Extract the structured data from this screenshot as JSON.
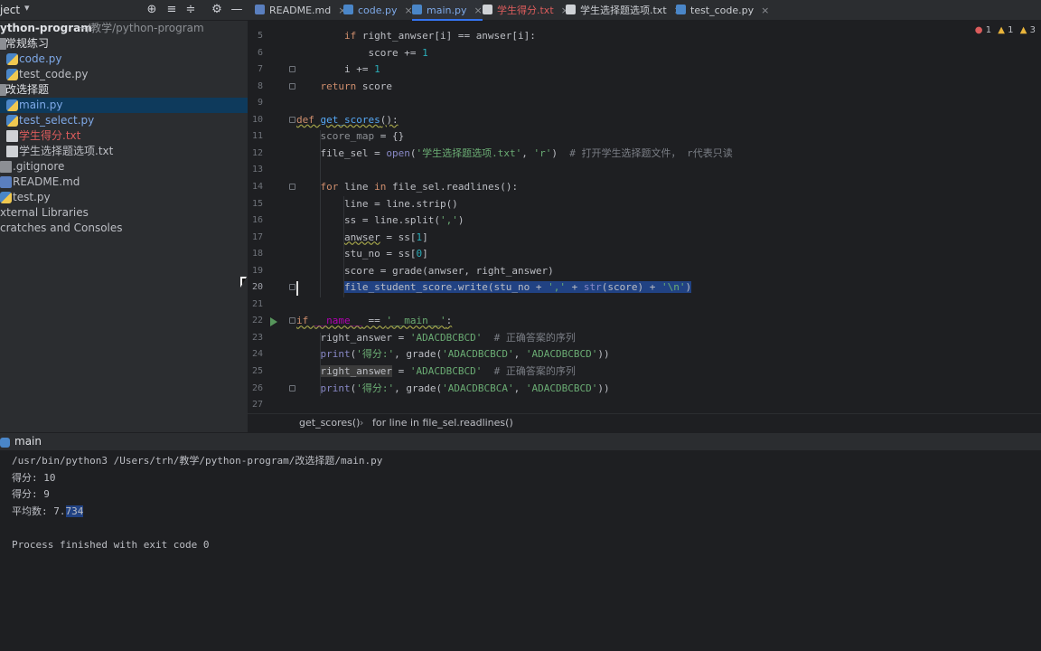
{
  "project": {
    "title": "ject",
    "root_name": "ython-program",
    "root_path": "~/教学/python-program",
    "items": [
      {
        "label": "常规练习",
        "kind": "folder",
        "indent": 0
      },
      {
        "label": "code.py",
        "kind": "py",
        "indent": 1,
        "color": "#7ea9e8"
      },
      {
        "label": "test_code.py",
        "kind": "py",
        "indent": 1,
        "color": "#bcbec4"
      },
      {
        "label": "改选择题",
        "kind": "folder",
        "indent": 0
      },
      {
        "label": "main.py",
        "kind": "py",
        "indent": 1,
        "color": "#7ea9e8",
        "selected": true
      },
      {
        "label": "test_select.py",
        "kind": "py",
        "indent": 1,
        "color": "#7ea9e8"
      },
      {
        "label": "学生得分.txt",
        "kind": "txt",
        "indent": 1,
        "color": "#db5c5c"
      },
      {
        "label": "学生选择题选项.txt",
        "kind": "txt",
        "indent": 1,
        "color": "#bcbec4"
      },
      {
        "label": ".gitignore",
        "kind": "file",
        "indent": 0,
        "color": "#bcbec4"
      },
      {
        "label": "README.md",
        "kind": "md",
        "indent": 0,
        "color": "#bcbec4"
      },
      {
        "label": "test.py",
        "kind": "py",
        "indent": 0,
        "color": "#bcbec4"
      },
      {
        "label": "xternal Libraries",
        "kind": "lib",
        "indent": -1,
        "color": "#bcbec4"
      },
      {
        "label": "cratches and Consoles",
        "kind": "lib",
        "indent": -1,
        "color": "#bcbec4"
      }
    ]
  },
  "tabs": [
    {
      "label": "README.md",
      "icon_color": "#5a7fbf",
      "color": "#c9ccd1"
    },
    {
      "label": "code.py",
      "icon_color": "#4a86c8",
      "color": "#7ea9e8"
    },
    {
      "label": "main.py",
      "icon_color": "#4a86c8",
      "color": "#7ea9e8",
      "active": true
    },
    {
      "label": "学生得分.txt",
      "icon_color": "#cfd2d6",
      "color": "#db5c5c"
    },
    {
      "label": "学生选择题选项.txt",
      "icon_color": "#cfd2d6",
      "color": "#c9ccd1"
    },
    {
      "label": "test_code.py",
      "icon_color": "#4a86c8",
      "color": "#c9ccd1"
    }
  ],
  "inspection": {
    "errors": "1",
    "warnings": "1",
    "weak": "3"
  },
  "editor": {
    "line_numbers": [
      "5",
      "6",
      "7",
      "8",
      "9",
      "10",
      "11",
      "12",
      "13",
      "14",
      "15",
      "16",
      "17",
      "18",
      "19",
      "20",
      "21",
      "22",
      "23",
      "24",
      "25",
      "26",
      "27"
    ],
    "current_line": "20",
    "lines": [
      [
        {
          "t": "        "
        },
        {
          "t": "if ",
          "c": "kw"
        },
        {
          "t": "right_anwser[i] == anwser[i]:"
        }
      ],
      [
        {
          "t": "            score += "
        },
        {
          "t": "1",
          "c": "num"
        }
      ],
      [
        {
          "t": "        i += "
        },
        {
          "t": "1",
          "c": "num"
        }
      ],
      [
        {
          "t": "    "
        },
        {
          "t": "return ",
          "c": "kw"
        },
        {
          "t": "score"
        }
      ],
      [
        {
          "t": ""
        }
      ],
      [
        {
          "t": "def ",
          "c": "kw ul"
        },
        {
          "t": "get_scores",
          "c": "fn ul"
        },
        {
          "t": "():",
          "c": "ul"
        }
      ],
      [
        {
          "t": "    "
        },
        {
          "t": "score_map",
          "c": "dim"
        },
        {
          "t": " = {}"
        }
      ],
      [
        {
          "t": "    file_sel = "
        },
        {
          "t": "open",
          "c": "bi"
        },
        {
          "t": "("
        },
        {
          "t": "'学生选择题选项.txt'",
          "c": "str"
        },
        {
          "t": ", "
        },
        {
          "t": "'r'",
          "c": "str"
        },
        {
          "t": ")  "
        },
        {
          "t": "# 打开学生选择题文件， r代表只读",
          "c": "cm"
        }
      ],
      [
        {
          "t": ""
        }
      ],
      [
        {
          "t": "    "
        },
        {
          "t": "for ",
          "c": "kw"
        },
        {
          "t": "line "
        },
        {
          "t": "in ",
          "c": "kw"
        },
        {
          "t": "file_sel.readlines():"
        }
      ],
      [
        {
          "t": "        line = line.strip()"
        }
      ],
      [
        {
          "t": "        ss = line.split("
        },
        {
          "t": "','",
          "c": "str"
        },
        {
          "t": ")"
        }
      ],
      [
        {
          "t": "        "
        },
        {
          "t": "anwser",
          "c": "ul"
        },
        {
          "t": " = ss["
        },
        {
          "t": "1",
          "c": "num"
        },
        {
          "t": "]"
        }
      ],
      [
        {
          "t": "        stu_no = ss["
        },
        {
          "t": "0",
          "c": "num"
        },
        {
          "t": "]"
        }
      ],
      [
        {
          "t": "        score = grade(anwser, right_answer)"
        }
      ],
      [
        {
          "t": "        "
        },
        {
          "t": "file_student_score.write(stu_no + ",
          "c": "sel-bg"
        },
        {
          "t": "','",
          "c": "str sel-bg"
        },
        {
          "t": " + ",
          "c": "sel-bg"
        },
        {
          "t": "str",
          "c": "bi sel-bg"
        },
        {
          "t": "(score) + ",
          "c": "sel-bg"
        },
        {
          "t": "'\\n'",
          "c": "str sel-bg"
        },
        {
          "t": ")",
          "c": "sel-bg"
        }
      ],
      [
        {
          "t": ""
        }
      ],
      [
        {
          "t": "if ",
          "c": "kw ul"
        },
        {
          "t": "__name__",
          "c": "dunder ul"
        },
        {
          "t": " == ",
          "c": "ul"
        },
        {
          "t": "'__main__'",
          "c": "str ul"
        },
        {
          "t": ":",
          "c": "ul"
        }
      ],
      [
        {
          "t": "    right_answer = "
        },
        {
          "t": "'ADACDBCBCD'",
          "c": "str"
        },
        {
          "t": "  "
        },
        {
          "t": "# 正确答案的序列",
          "c": "cm"
        }
      ],
      [
        {
          "t": "    "
        },
        {
          "t": "print",
          "c": "bi"
        },
        {
          "t": "("
        },
        {
          "t": "'得分:'",
          "c": "str"
        },
        {
          "t": ", grade("
        },
        {
          "t": "'ADACDBCBCD'",
          "c": "str"
        },
        {
          "t": ", "
        },
        {
          "t": "'ADACDBCBCD'",
          "c": "str"
        },
        {
          "t": "))"
        }
      ],
      [
        {
          "t": "    "
        },
        {
          "t": "right_answer",
          "c": "hl"
        },
        {
          "t": " = "
        },
        {
          "t": "'ADACDBCBCD'",
          "c": "str"
        },
        {
          "t": "  "
        },
        {
          "t": "# 正确答案的序列",
          "c": "cm"
        }
      ],
      [
        {
          "t": "    "
        },
        {
          "t": "print",
          "c": "bi"
        },
        {
          "t": "("
        },
        {
          "t": "'得分:'",
          "c": "str"
        },
        {
          "t": ", grade("
        },
        {
          "t": "'ADACDBCBCA'",
          "c": "str"
        },
        {
          "t": ", "
        },
        {
          "t": "'ADACDBCBCD'",
          "c": "str"
        },
        {
          "t": "))"
        }
      ],
      [
        {
          "t": ""
        }
      ]
    ]
  },
  "breadcrumb": {
    "fn": "get_scores()",
    "sep": "›",
    "loop": "for line in file_sel.readlines()"
  },
  "run": {
    "title": "main",
    "output": [
      "/usr/bin/python3 /Users/trh/教学/python-program/改选择题/main.py",
      "得分: 10",
      "得分: 9",
      "平均数: 7.734",
      "",
      "Process finished with exit code 0"
    ]
  }
}
